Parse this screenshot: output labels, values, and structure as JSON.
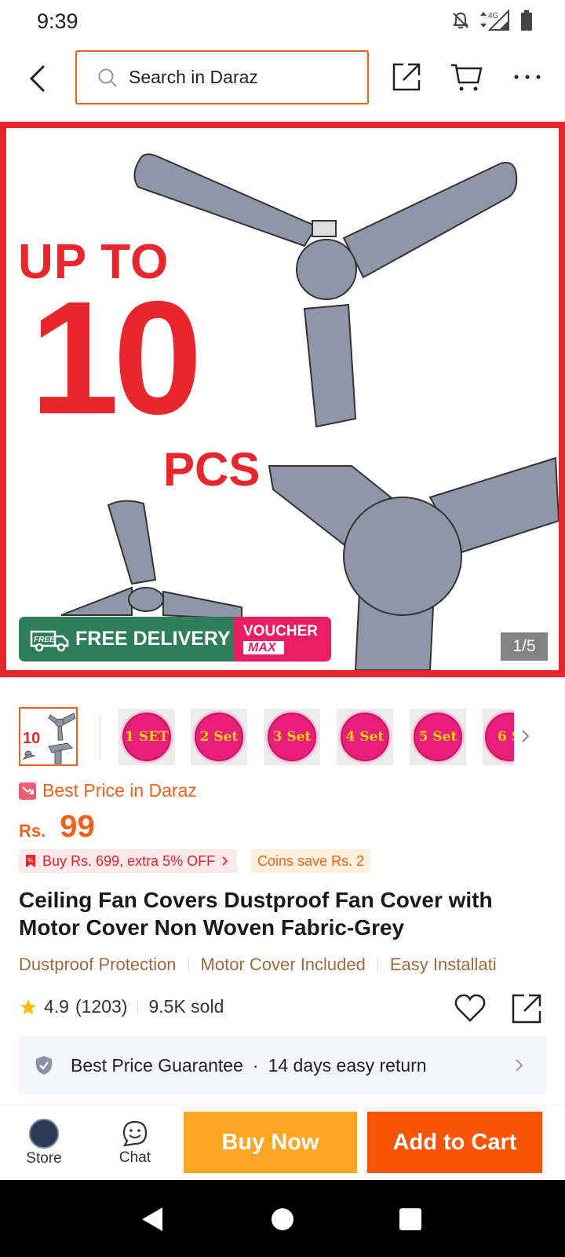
{
  "status_bar": {
    "time": "9:39",
    "network": "4G"
  },
  "search": {
    "placeholder": "Search in Daraz"
  },
  "gallery": {
    "promo_line1": "UP TO",
    "promo_number": "10",
    "promo_line3": "PCS",
    "free_delivery": "FREE DELIVERY",
    "free_tag": "FREE",
    "voucher": "VOUCHER",
    "voucher_max": "MAX",
    "page_indicator": "1/5"
  },
  "thumbnails": {
    "first_label": "10",
    "sets": [
      "1 SET",
      "2 Set",
      "3 Set",
      "4 Set",
      "5 Set",
      "6 S"
    ]
  },
  "price_block": {
    "best_price": "Best Price in Daraz",
    "currency": "Rs.",
    "price": "99",
    "promo1": "Buy Rs. 699, extra 5% OFF",
    "promo2": "Coins save Rs. 2"
  },
  "product": {
    "title": "Ceiling Fan Covers Dustproof Fan Cover with Motor Cover Non Woven Fabric-Grey",
    "features": [
      "Dustproof Protection",
      "Motor Cover Included",
      "Easy Installati"
    ],
    "rating": "4.9",
    "reviews": "(1203)",
    "sold": "9.5K sold"
  },
  "guarantee": {
    "text1": "Best Price Guarantee",
    "dot": "·",
    "text2": "14 days easy return"
  },
  "bottom_bar": {
    "store": "Store",
    "chat": "Chat",
    "buy_now": "Buy Now",
    "add_to_cart": "Add to Cart"
  },
  "colors": {
    "accent": "#f85606",
    "buy": "#fca624",
    "promo_red": "#e8262c"
  },
  "icons": [
    "back-arrow-icon",
    "search-icon",
    "share-icon",
    "cart-icon",
    "more-icon",
    "wishlist-heart-icon",
    "star-icon",
    "shield-icon",
    "chat-icon"
  ]
}
